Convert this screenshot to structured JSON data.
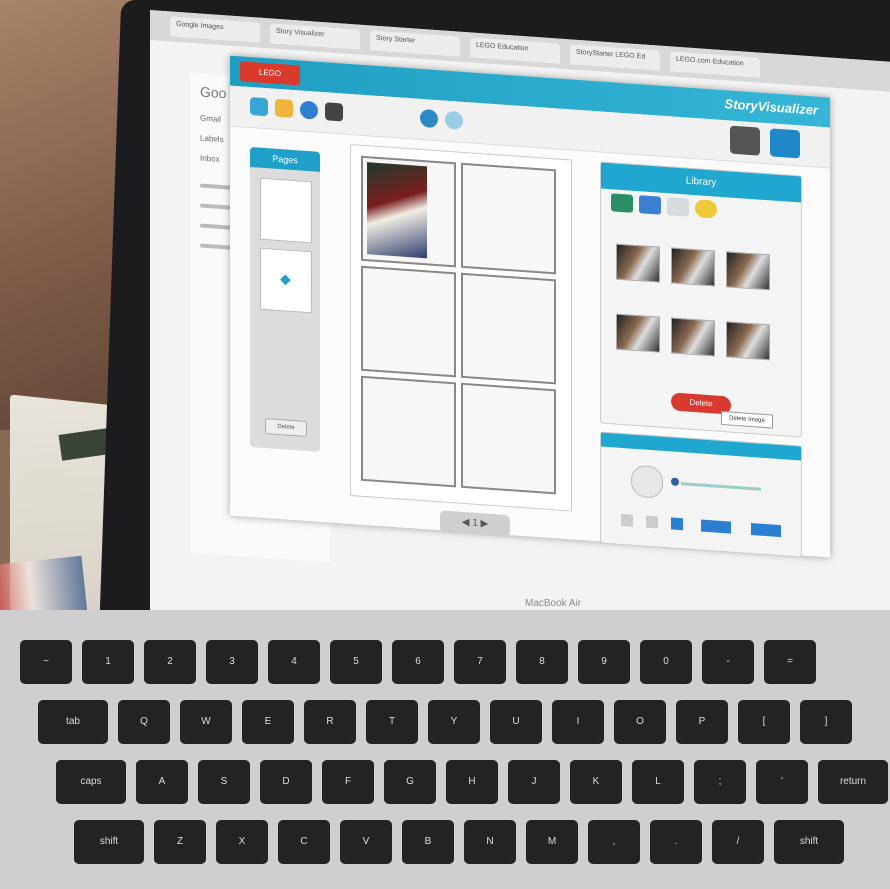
{
  "scene": {
    "description_type": "photo-of-laptop-screen",
    "device_label": "MacBook Air"
  },
  "browser": {
    "tabs": [
      "Google Images",
      "Story Visualizer",
      "Story Starter",
      "LEGO Education",
      "StoryStarter LEGO Ed",
      "LEGO.com Education"
    ]
  },
  "background_page": {
    "title_partial": "Goo",
    "lines": [
      "Gmail",
      "Labels",
      "Inbox"
    ]
  },
  "app": {
    "logo_label": "LEGO Education",
    "brand": "StoryVisualizer",
    "pages_label": "Pages",
    "pages_delete_label": "Delete",
    "library_label": "Library",
    "delete_button_label": "Delete",
    "tooltip_label": "Delete Image",
    "page_nav": "1",
    "colors": {
      "header": "#1f9ec2",
      "accent_red": "#d83a2f"
    }
  },
  "keyboard": {
    "rows": [
      [
        "~",
        "1",
        "2",
        "3",
        "4",
        "5",
        "6",
        "7",
        "8",
        "9",
        "0",
        "-",
        "="
      ],
      [
        "tab",
        "Q",
        "W",
        "E",
        "R",
        "T",
        "Y",
        "U",
        "I",
        "O",
        "P",
        "[",
        "]"
      ],
      [
        "caps",
        "A",
        "S",
        "D",
        "F",
        "G",
        "H",
        "J",
        "K",
        "L",
        ";",
        "'",
        "return"
      ],
      [
        "shift",
        "Z",
        "X",
        "C",
        "V",
        "B",
        "N",
        "M",
        ",",
        ".",
        "/",
        "shift"
      ]
    ]
  }
}
